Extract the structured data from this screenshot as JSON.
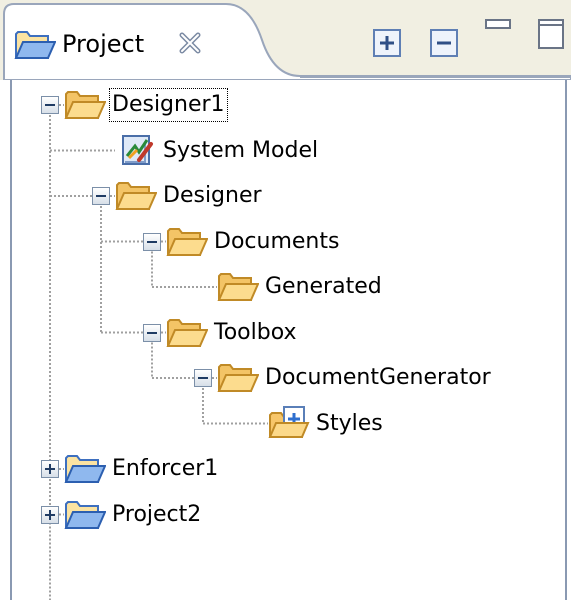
{
  "view": {
    "tab_label": "Project",
    "tab_icon": "project-folder-icon",
    "toolbar": {
      "expand_all_icon": "expand-all-icon",
      "collapse_all_icon": "collapse-all-icon",
      "minimize_icon": "minimize-icon",
      "maximize_icon": "maximize-icon",
      "close_icon": "close-tab-icon"
    }
  },
  "tree": [
    {
      "label": "Designer1",
      "icon": "folder-icon",
      "toggle": "minus",
      "focused": true
    },
    {
      "label": "System Model",
      "icon": "system-model-icon",
      "toggle": null
    },
    {
      "label": "Designer",
      "icon": "folder-icon",
      "toggle": "minus"
    },
    {
      "label": "Documents",
      "icon": "folder-icon",
      "toggle": "minus"
    },
    {
      "label": "Generated",
      "icon": "folder-icon",
      "toggle": null
    },
    {
      "label": "Toolbox",
      "icon": "folder-icon",
      "toggle": "minus"
    },
    {
      "label": "DocumentGenerator",
      "icon": "folder-icon",
      "toggle": "minus"
    },
    {
      "label": "Styles",
      "icon": "styles-icon",
      "toggle": null
    },
    {
      "label": "Enforcer1",
      "icon": "project-folder-icon",
      "toggle": "plus"
    },
    {
      "label": "Project2",
      "icon": "project-folder-icon",
      "toggle": "plus"
    }
  ],
  "colors": {
    "folder": "#f7c66a",
    "folder_outline": "#c08a26",
    "project_folder_blue": "#5a8fd8",
    "tree_line": "#a0a0a0",
    "toggle_border": "#7b8fa8"
  }
}
